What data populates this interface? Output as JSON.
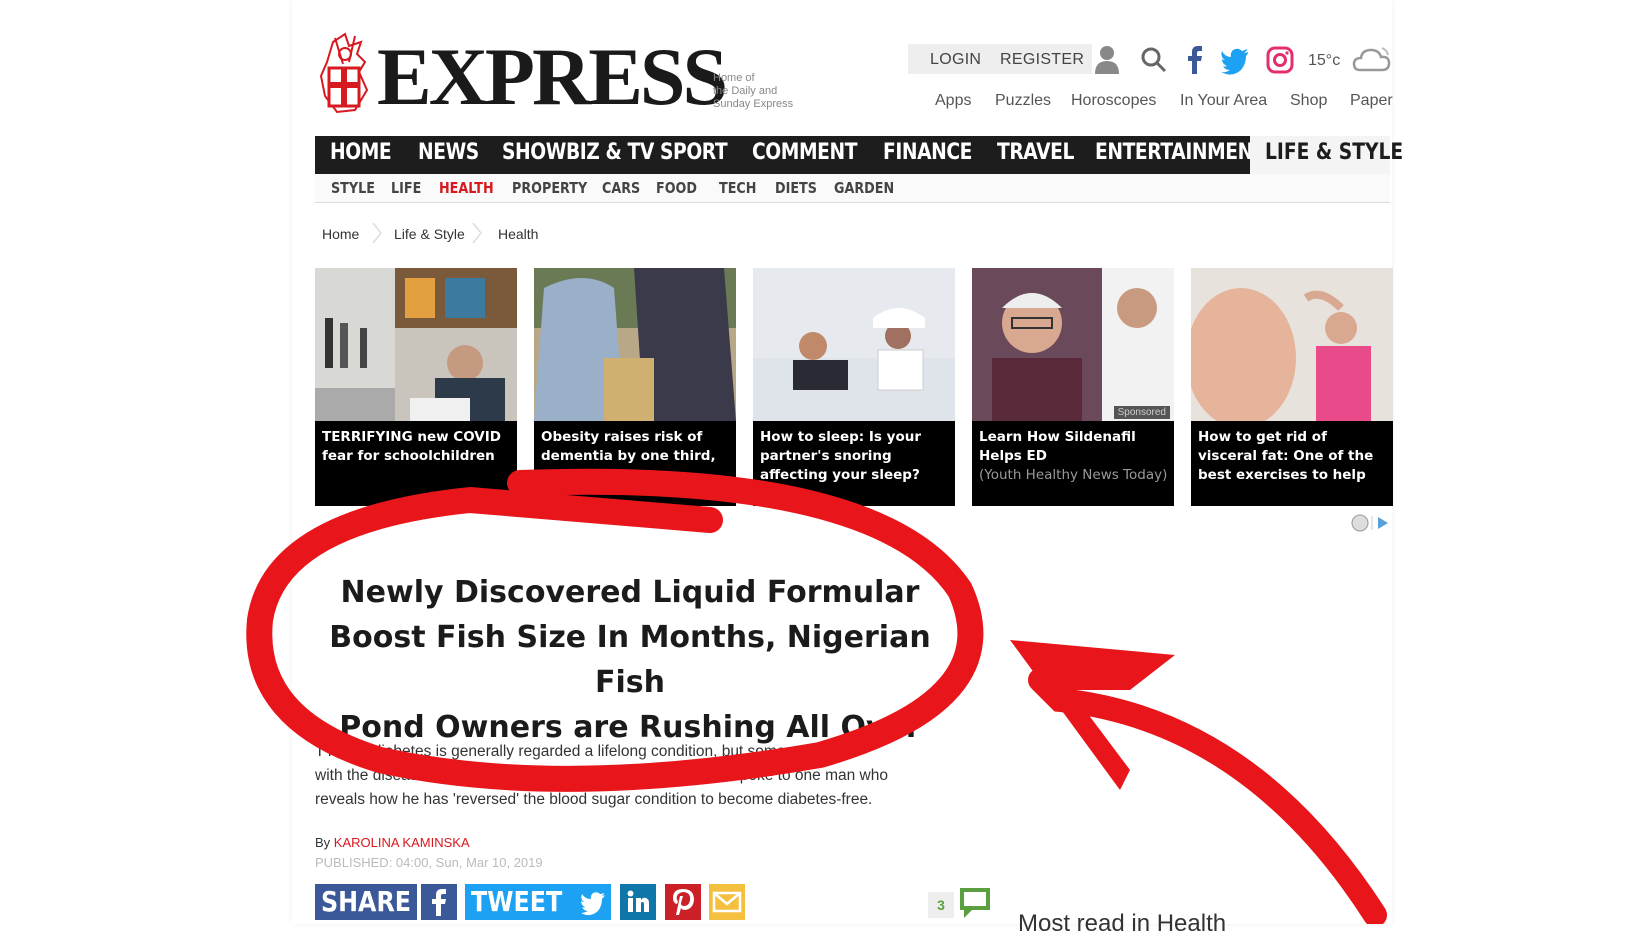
{
  "header": {
    "logo_text": "EXPRESS",
    "logo_tagline": [
      "Home of",
      "the Daily and",
      "Sunday Express"
    ],
    "login_label": "LOGIN",
    "register_label": "REGISTER",
    "temperature": "15°c",
    "sub_links": [
      "Apps",
      "Puzzles",
      "Horoscopes",
      "In Your Area",
      "Shop",
      "Paper"
    ]
  },
  "nav": {
    "items": [
      "HOME",
      "NEWS",
      "SHOWBIZ & TV",
      "SPORT",
      "COMMENT",
      "FINANCE",
      "TRAVEL",
      "ENTERTAINMENT"
    ],
    "active": "LIFE & STYLE",
    "sub_items": [
      "STYLE",
      "LIFE",
      "HEALTH",
      "PROPERTY",
      "CARS",
      "FOOD",
      "TECH",
      "DIETS",
      "GARDEN"
    ],
    "sub_active": "HEALTH"
  },
  "breadcrumb": [
    "Home",
    "Life & Style",
    "Health"
  ],
  "cards": [
    {
      "caption": "TERRIFYING new COVID fear for schoolchildren"
    },
    {
      "caption": "Obesity raises risk of dementia by one third, study finds"
    },
    {
      "caption": "How to sleep: Is your partner's snoring affecting your sleep? A..."
    },
    {
      "caption": "Learn How Sildenafil Helps ED",
      "source": "(Youth Healthy News Today)",
      "badge": "Sponsored"
    },
    {
      "caption": "How to get rid of visceral fat: One of the best exercises to help you..."
    }
  ],
  "headline": {
    "line1": "Newly Discovered Liquid Formular",
    "line2": "Boost Fish Size In Months, Nigerian Fish",
    "line3": "Pond Owners are Rushing All Over"
  },
  "article": {
    "body_line1": "TYPE 2 diabetes is generally regarded a lifelong condition, but some people",
    "body_line2": "with the disease have been able to reverse it. Express.co.uk spoke to one man who",
    "body_line3": "reveals how he has 'reversed' the blood sugar condition to become diabetes-free.",
    "by_prefix": "By",
    "author": "KAROLINA KAMINSKA",
    "published": "PUBLISHED: 04:00, Sun, Mar 10, 2019",
    "share_label": "SHARE",
    "tweet_label": "TWEET",
    "comment_count": "3",
    "most_read": "Most read in Health"
  },
  "colors": {
    "brand_red": "#d71920",
    "nav_bg": "#1d1d1d",
    "facebook": "#3b5998",
    "twitter": "#1da1f2",
    "circle_red": "#e8161b"
  }
}
